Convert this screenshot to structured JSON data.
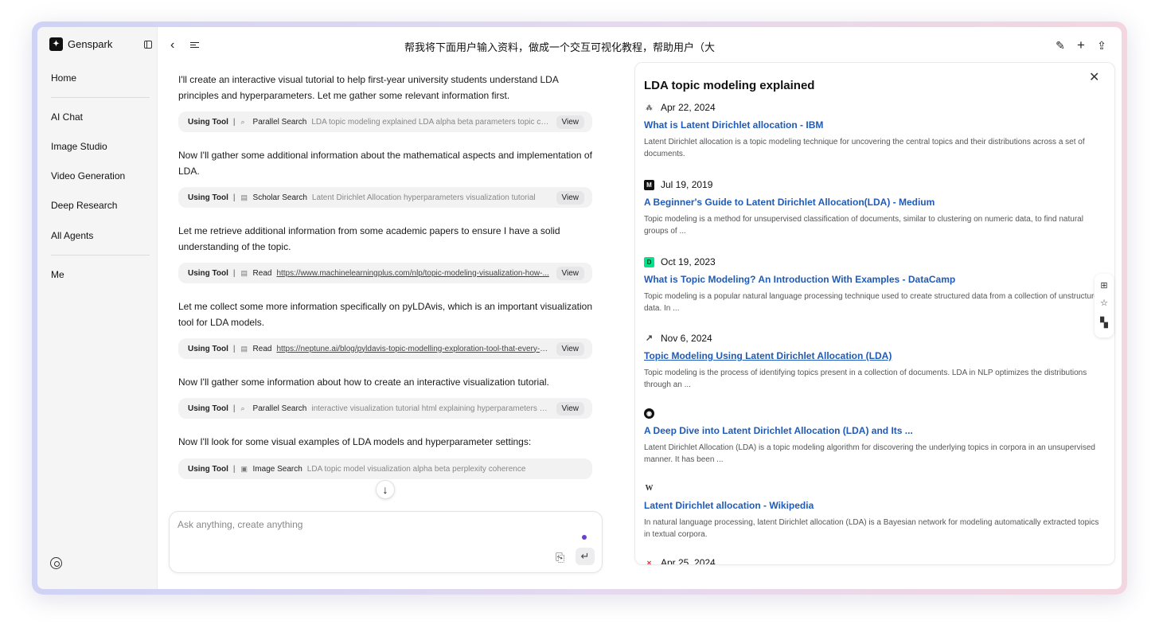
{
  "app": {
    "brand": "Genspark"
  },
  "sidebar": {
    "items": [
      {
        "label": "Home"
      },
      {
        "label": "AI Chat"
      },
      {
        "label": "Image Studio"
      },
      {
        "label": "Video Generation"
      },
      {
        "label": "Deep Research"
      },
      {
        "label": "All Agents"
      },
      {
        "label": "Me"
      }
    ]
  },
  "header": {
    "title": "帮我将下面用户输入资料，做成一个交互可视化教程，帮助用户（大"
  },
  "chat": {
    "messages": [
      "I'll create an interactive visual tutorial to help first-year university students understand LDA principles and hyperparameters. Let me gather some relevant information first.",
      "Now I'll gather some additional information about the mathematical aspects and implementation of LDA.",
      "Let me retrieve additional information from some academic papers to ensure I have a solid understanding of the topic.",
      "Let me collect some more information specifically on pyLDAvis, which is an important visualization tool for LDA models.",
      "Now I'll gather some information about how to create an interactive visualization tutorial.",
      "Now I'll look for some visual examples of LDA models and hyperparameter settings:"
    ],
    "tools": [
      {
        "using": "Using Tool",
        "sep": "|",
        "icon": "search-icon",
        "name": "Parallel Search",
        "detail": "LDA topic modeling explained LDA alpha beta parameters topic coherence",
        "view": "View"
      },
      {
        "using": "Using Tool",
        "sep": "|",
        "icon": "document-icon",
        "name": "Scholar Search",
        "detail": "Latent Dirichlet Allocation hyperparameters visualization tutorial",
        "view": "View"
      },
      {
        "using": "Using Tool",
        "sep": "|",
        "icon": "document-icon",
        "name": "Read",
        "detail": "https://www.machinelearningplus.com/nlp/topic-modeling-visualization-how-...",
        "view": "View"
      },
      {
        "using": "Using Tool",
        "sep": "|",
        "icon": "document-icon",
        "name": "Read",
        "detail": "https://neptune.ai/blog/pyldavis-topic-modelling-exploration-tool-that-every-n...",
        "view": "View"
      },
      {
        "using": "Using Tool",
        "sep": "|",
        "icon": "search-icon",
        "name": "Parallel Search",
        "detail": "interactive visualization tutorial html explaining hyperparameters LDA",
        "view": "View"
      },
      {
        "using": "Using Tool",
        "sep": "|",
        "icon": "image-icon",
        "name": "Image Search",
        "detail": "LDA topic model visualization alpha beta perplexity coherence"
      }
    ],
    "input_placeholder": "Ask anything, create anything"
  },
  "panel": {
    "title": "LDA topic modeling explained",
    "results": [
      {
        "date": "Apr 22, 2024",
        "favicon": "ibm-icon",
        "title": "What is Latent Dirichlet allocation - IBM",
        "snippet": "Latent Dirichlet allocation is a topic modeling technique for uncovering the central topics and their distributions across a set of documents."
      },
      {
        "date": "Jul 19, 2019",
        "favicon": "medium-icon",
        "title": "A Beginner's Guide to Latent Dirichlet Allocation(LDA) - Medium",
        "snippet": "Topic modeling is a method for unsupervised classification of documents, similar to clustering on numeric data, to find natural groups of ..."
      },
      {
        "date": "Oct 19, 2023",
        "favicon": "datacamp-icon",
        "title": "What is Topic Modeling? An Introduction With Examples - DataCamp",
        "snippet": "Topic modeling is a popular natural language processing technique used to create structured data from a collection of unstructured data. In ..."
      },
      {
        "date": "Nov 6, 2024",
        "favicon": "trend-icon",
        "title": "Topic Modeling Using Latent Dirichlet Allocation (LDA)",
        "snippet": "Topic modeling is the process of identifying topics present in a collection of documents. LDA in NLP optimizes the distributions through an ..."
      },
      {
        "date": "",
        "favicon": "site-icon",
        "title": "A Deep Dive into Latent Dirichlet Allocation (LDA) and Its ...",
        "snippet": "Latent Dirichlet Allocation (LDA) is a topic modeling algorithm for discovering the underlying topics in corpora in an unsupervised manner. It has been ..."
      },
      {
        "date": "",
        "favicon": "wikipedia-icon",
        "title": "Latent Dirichlet allocation - Wikipedia",
        "snippet": "In natural language processing, latent Dirichlet allocation (LDA) is a Bayesian network for modeling automatically extracted topics in textual corpora."
      },
      {
        "date": "Apr 25, 2024",
        "favicon": "site-icon-2"
      }
    ]
  },
  "colors": {
    "link": "#1f5bb8",
    "accent_dot": "#6a3fd6"
  }
}
